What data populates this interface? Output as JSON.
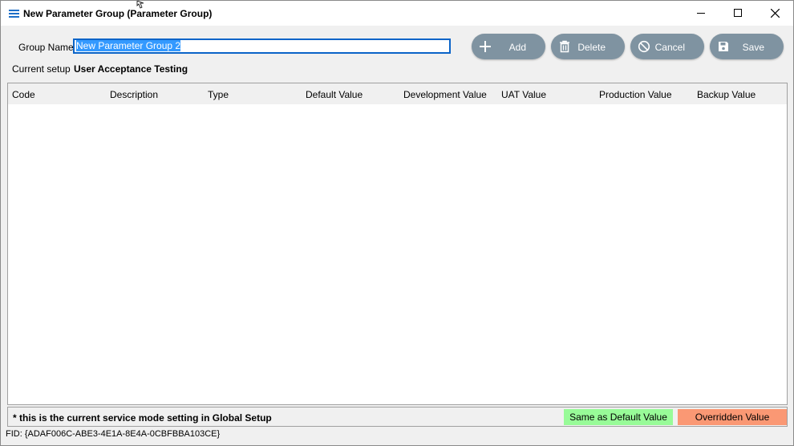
{
  "window": {
    "title": "New Parameter Group (Parameter Group)",
    "icon": "menu-lines-icon"
  },
  "form": {
    "group_name_label": "Group Name",
    "group_name_value": "New Parameter Group 2",
    "current_setup_label": "Current setup",
    "current_setup_value": "User Acceptance Testing"
  },
  "toolbar": {
    "add_label": "Add",
    "delete_label": "Delete",
    "cancel_label": "Cancel",
    "save_label": "Save",
    "button_color": "#7f93a1"
  },
  "grid": {
    "columns": [
      "Code",
      "Description",
      "Type",
      "Default Value",
      "Development Value",
      "UAT Value",
      "Production Value",
      "Backup Value"
    ],
    "rows": []
  },
  "footer": {
    "note": "* this is the current service mode setting in Global Setup",
    "legend_same": "Same as Default Value",
    "legend_same_color": "#98fb98",
    "legend_overridden": "Overridden Value",
    "legend_overridden_color": "#fa9874",
    "fid": "FID: {ADAF006C-ABE3-4E1A-8E4A-0CBFBBA103CE}"
  }
}
